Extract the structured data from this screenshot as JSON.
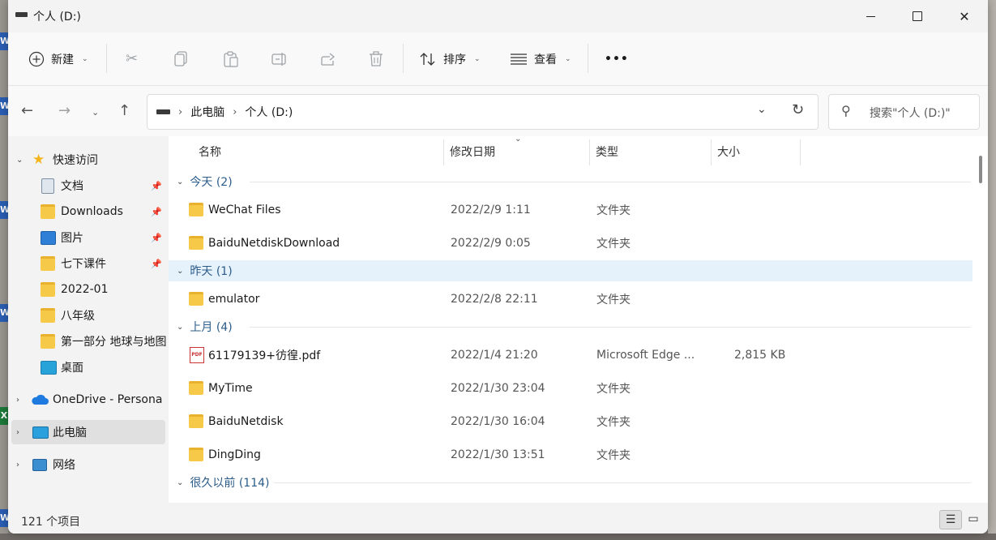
{
  "window": {
    "title": "个人 (D:)"
  },
  "toolbar": {
    "new_label": "新建",
    "sort_label": "排序",
    "view_label": "查看",
    "more_label": "•••"
  },
  "address": {
    "crumbs": [
      "此电脑",
      "个人 (D:)"
    ],
    "search_placeholder": "搜索\"个人 (D:)\""
  },
  "sidebar": {
    "quick_access": "快速访问",
    "items": [
      {
        "label": "文档",
        "icon": "document-icon",
        "pinned": true
      },
      {
        "label": "Downloads",
        "icon": "folder-icon",
        "pinned": true
      },
      {
        "label": "图片",
        "icon": "pictures-icon",
        "pinned": true
      },
      {
        "label": "七下课件",
        "icon": "folder-icon",
        "pinned": true
      },
      {
        "label": "2022-01",
        "icon": "folder-icon",
        "pinned": false
      },
      {
        "label": "八年级",
        "icon": "folder-icon",
        "pinned": false
      },
      {
        "label": "第一部分 地球与地图",
        "icon": "folder-icon",
        "pinned": false
      },
      {
        "label": "桌面",
        "icon": "desktop-icon",
        "pinned": false
      }
    ],
    "onedrive": "OneDrive - Persona",
    "this_pc": "此电脑",
    "network": "网络"
  },
  "columns": {
    "name": "名称",
    "date": "修改日期",
    "type": "类型",
    "size": "大小"
  },
  "groups": [
    {
      "label": "今天 (2)",
      "rows": [
        {
          "name": "WeChat Files",
          "date": "2022/2/9 1:11",
          "type": "文件夹",
          "size": ""
        },
        {
          "name": "BaiduNetdiskDownload",
          "date": "2022/2/9 0:05",
          "type": "文件夹",
          "size": ""
        }
      ]
    },
    {
      "label": "昨天 (1)",
      "rows": [
        {
          "name": "emulator",
          "date": "2022/2/8 22:11",
          "type": "文件夹",
          "size": ""
        }
      ]
    },
    {
      "label": "上月 (4)",
      "rows": [
        {
          "name": "61179139+彷徨.pdf",
          "date": "2022/1/4 21:20",
          "type": "Microsoft Edge ...",
          "size": "2,815 KB"
        },
        {
          "name": "MyTime",
          "date": "2022/1/30 23:04",
          "type": "文件夹",
          "size": ""
        },
        {
          "name": "BaiduNetdisk",
          "date": "2022/1/30 16:04",
          "type": "文件夹",
          "size": ""
        },
        {
          "name": "DingDing",
          "date": "2022/1/30 13:51",
          "type": "文件夹",
          "size": ""
        }
      ]
    },
    {
      "label": "很久以前 (114)",
      "rows": []
    }
  ],
  "status": {
    "count": "121 个项目"
  },
  "colors": {
    "folder": "#f7c948",
    "group_text": "#2b5c8a",
    "highlight": "#e5f1fb"
  }
}
